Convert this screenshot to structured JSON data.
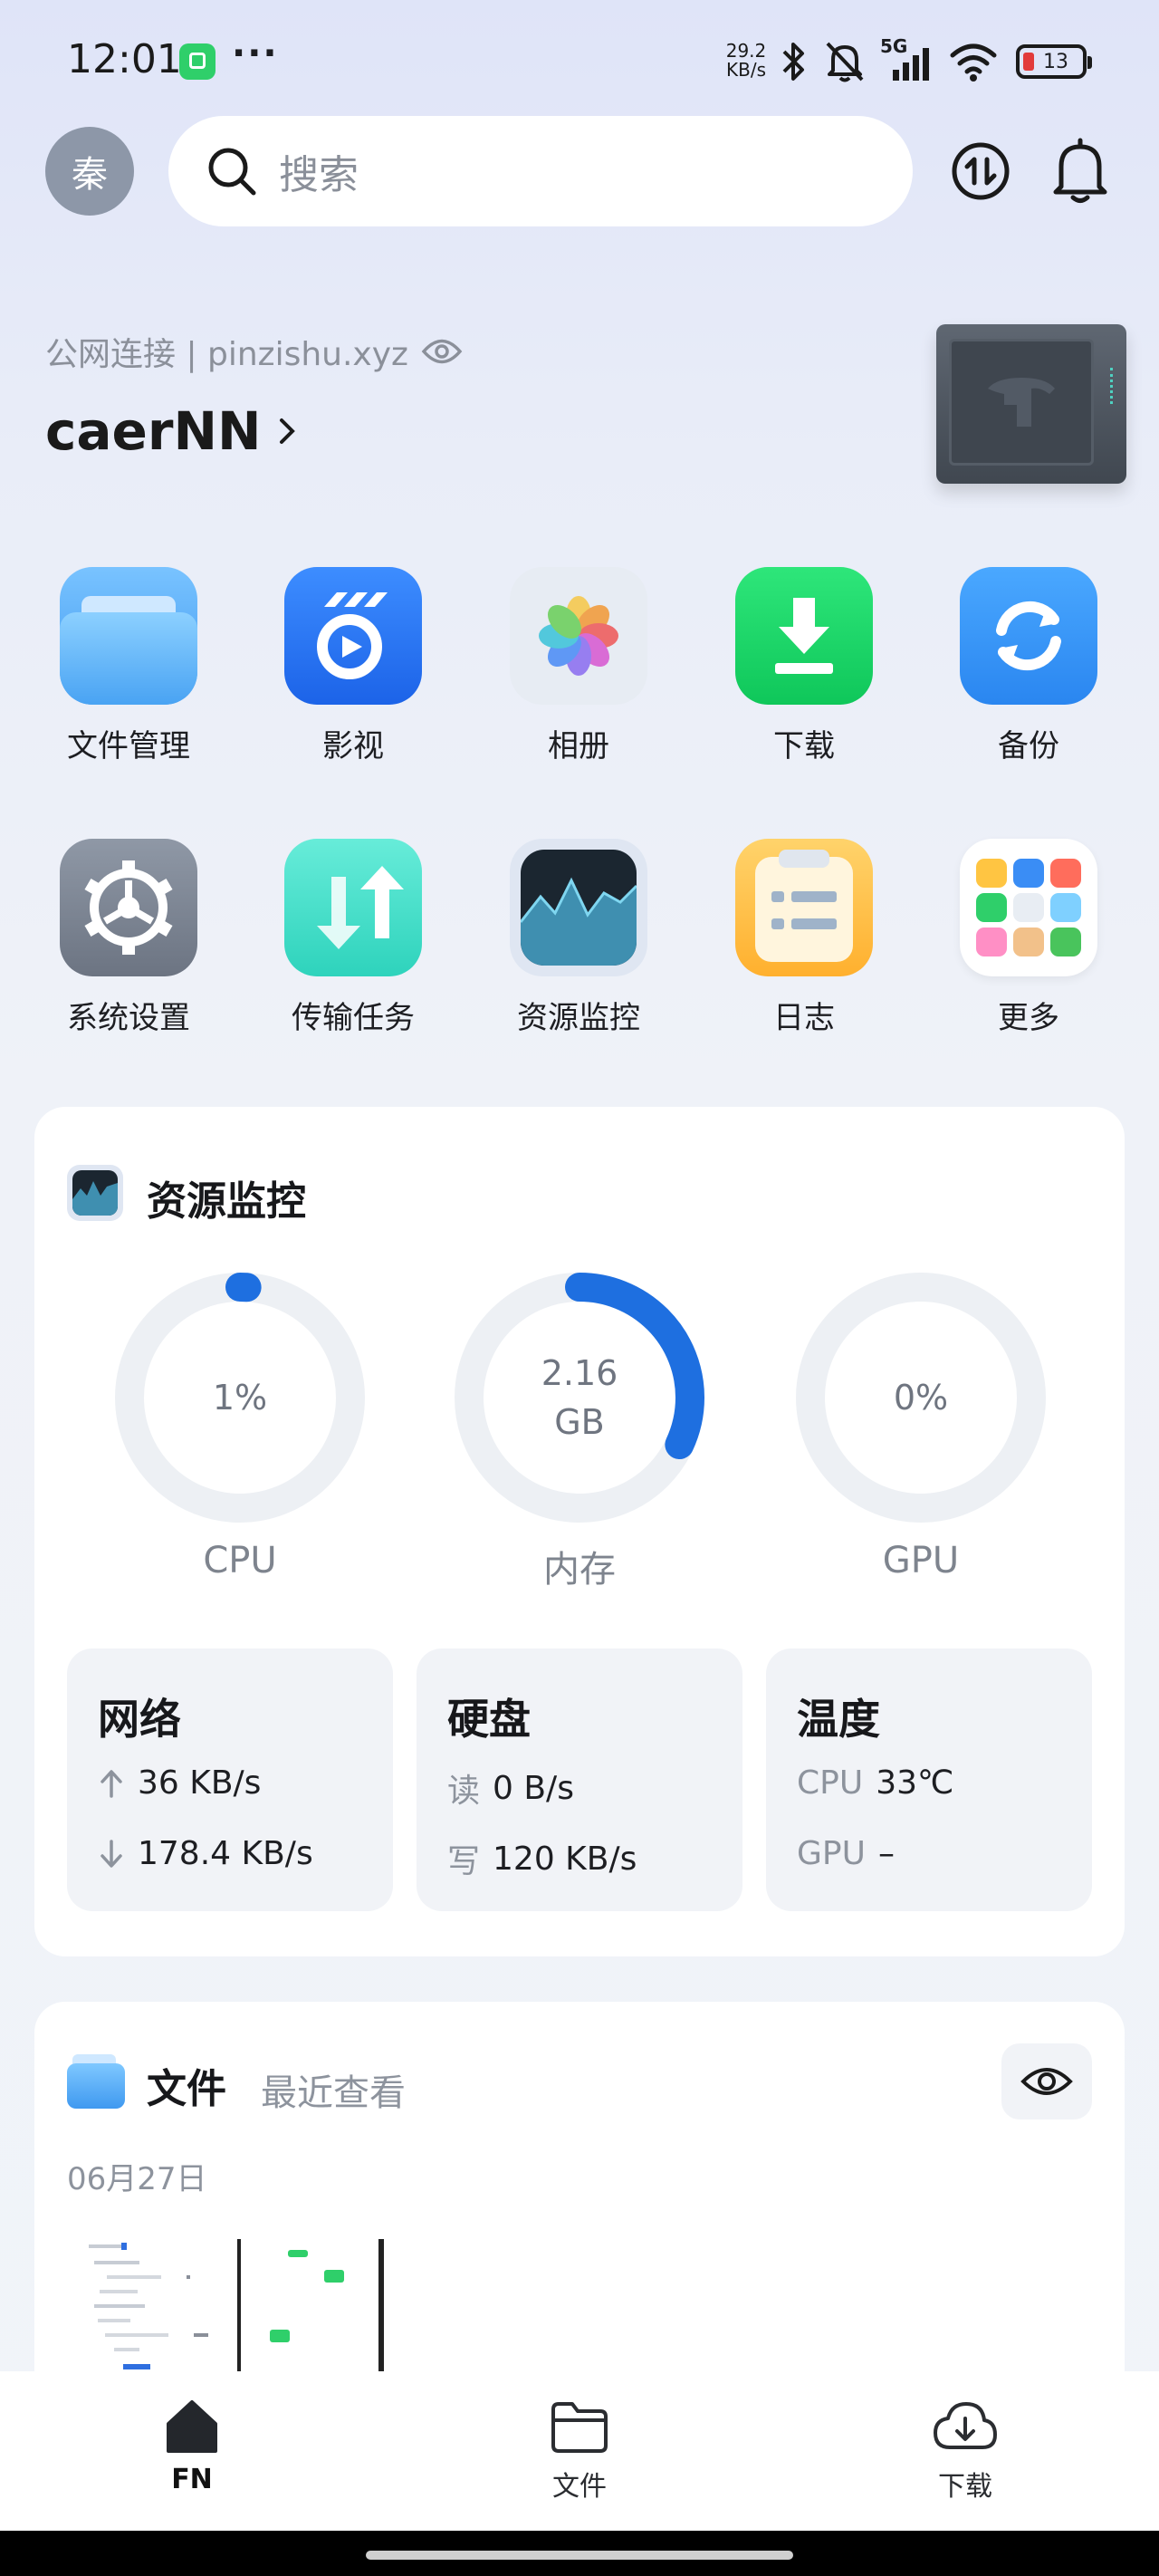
{
  "status_bar": {
    "time": "12:01",
    "net_speed_value": "29.2",
    "net_speed_unit": "KB/s",
    "network": "5G",
    "battery": "13"
  },
  "header": {
    "avatar_text": "秦",
    "search_placeholder": "搜索"
  },
  "device": {
    "connection": "公网连接 | pinzishu.xyz",
    "name": "caerNN"
  },
  "apps": [
    {
      "label": "文件管理",
      "icon": "folder-icon"
    },
    {
      "label": "影视",
      "icon": "video-icon"
    },
    {
      "label": "相册",
      "icon": "photos-icon"
    },
    {
      "label": "下载",
      "icon": "download-icon"
    },
    {
      "label": "备份",
      "icon": "backup-icon"
    },
    {
      "label": "系统设置",
      "icon": "settings-gear-icon"
    },
    {
      "label": "传输任务",
      "icon": "transfer-tasks-icon"
    },
    {
      "label": "资源监控",
      "icon": "resource-monitor-icon"
    },
    {
      "label": "日志",
      "icon": "log-icon"
    },
    {
      "label": "更多",
      "icon": "more-apps-icon"
    }
  ],
  "monitor": {
    "title": "资源监控",
    "gauges": [
      {
        "label": "CPU",
        "value_line1": "1%",
        "value_line2": "",
        "fill": 0.01
      },
      {
        "label": "内存",
        "value_line1": "2.16",
        "value_line2": "GB",
        "fill": 0.32
      },
      {
        "label": "GPU",
        "value_line1": "0%",
        "value_line2": "",
        "fill": 0
      }
    ],
    "network": {
      "title": "网络",
      "upload": "36 KB/s",
      "download": "178.4 KB/s"
    },
    "disk": {
      "title": "硬盘",
      "read_key": "读",
      "read": "0 B/s",
      "write_key": "写",
      "write": "120 KB/s"
    },
    "temperature": {
      "title": "温度",
      "cpu_key": "CPU",
      "cpu": "33℃",
      "gpu_key": "GPU",
      "gpu": "–"
    }
  },
  "files": {
    "title": "文件",
    "subtitle": "最近查看",
    "date": "06月27日"
  },
  "bottom_nav": [
    {
      "label": "FN",
      "icon": "home-icon",
      "active": true
    },
    {
      "label": "文件",
      "icon": "folder-outline-icon",
      "active": false
    },
    {
      "label": "下载",
      "icon": "cloud-download-icon",
      "active": false
    }
  ],
  "colors": {
    "accent": "#1e6fe0",
    "gauge_track": "#edf0f4",
    "card_bg": "#ffffff"
  }
}
